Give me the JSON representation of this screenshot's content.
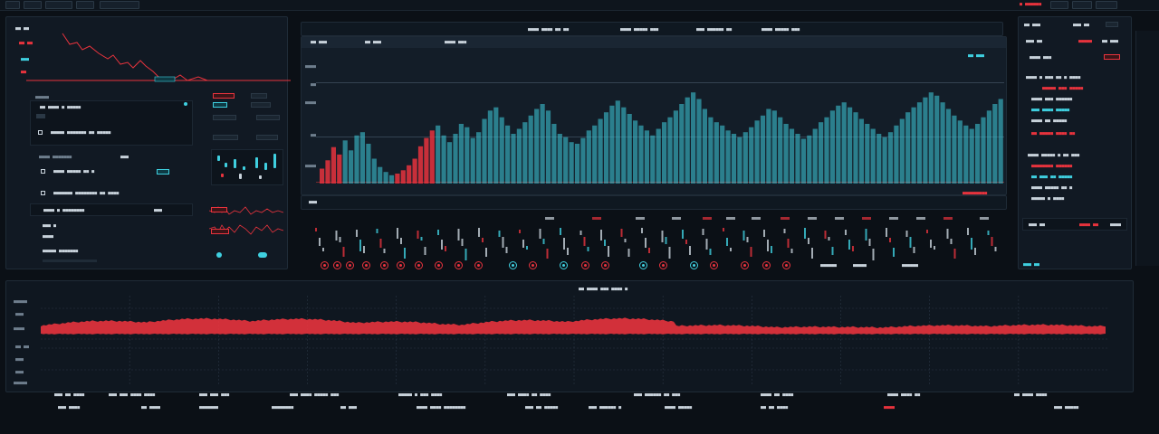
{
  "topbar": {
    "left_btns": [
      "",
      "",
      "",
      ""
    ],
    "right_red_label": "■ ■■■■■■",
    "right_items": [
      "■■",
      "■■■",
      "■■■"
    ]
  },
  "left_panel": {
    "mini_chart": {
      "labels": [
        "■■ ■■",
        "■■■",
        "■■",
        "■■"
      ],
      "header": "■■ ■■"
    },
    "list_a": {
      "title": "■■■■■",
      "rows": [
        "■■ ■■■■ ■ ■■■■■",
        "■■■■■ ■■■■■■■ ■■ ■■■■■"
      ]
    },
    "list_b": {
      "title": "■■■■ ■■■■■■■",
      "value": "■■■",
      "rows": [
        "■■■■ ■■■■■ ■■ ■",
        "■■■■■■■ ■■■■■■■■ ■■ ■■■■"
      ],
      "chip": "■■"
    },
    "list_c": {
      "rows": [
        "■■■■ ■ ■■■■■■■■",
        "■■■ ■",
        "■■■■",
        "■■■■■ ■■■■■■■"
      ],
      "value": "■■■"
    }
  },
  "mid_controls": {
    "labels": [
      "■■■■■■",
      "■■■■■",
      "■■■■■■",
      "■■■■■",
      "■■■■■■",
      "■■■■■"
    ]
  },
  "main_chart": {
    "toolbar": [
      "■■ ■■■",
      "■■ ■■■",
      "■■■■ ■■■"
    ],
    "top_tabs": [
      "■■■■ ■■■■ ■■ ■■",
      "■■■■ ■■■■■ ■■■",
      "■■■ ■■■■■■ ■■",
      "■■■■ ■■■■■ ■■■"
    ],
    "right_label": "■■ ■■■",
    "y_labels": [
      "■■■■",
      "■■",
      "■■■■",
      "■■",
      "■■■■"
    ],
    "bottom_left": "■■■",
    "bottom_right": "■■■■■■■■■"
  },
  "chart_data": {
    "type": "bar",
    "title": "",
    "series": [
      {
        "name": "",
        "values": [
          18,
          28,
          44,
          35,
          52,
          40,
          58,
          62,
          48,
          30,
          20,
          14,
          10,
          12,
          16,
          22,
          30,
          45,
          55,
          64,
          70,
          58,
          50,
          60,
          72,
          68,
          55,
          62,
          78,
          88,
          92,
          80,
          70,
          60,
          66,
          74,
          82,
          90,
          96,
          88,
          72,
          60,
          56,
          50,
          48,
          55,
          64,
          70,
          78,
          86,
          94,
          100,
          92,
          84,
          76,
          70,
          64,
          58,
          66,
          74,
          80,
          88,
          96,
          104,
          110,
          102,
          90,
          80,
          74,
          70,
          64,
          60,
          56,
          62,
          68,
          76,
          82,
          90,
          88,
          80,
          72,
          66,
          60,
          54,
          58,
          66,
          74,
          80,
          88,
          94,
          98,
          92,
          86,
          78,
          72,
          66,
          60,
          56,
          62,
          70,
          78,
          86,
          92,
          98,
          104,
          110,
          106,
          98,
          90,
          82,
          76,
          70,
          66,
          72,
          80,
          88,
          96,
          102
        ]
      }
    ]
  },
  "wave_chart": {
    "title": "■■ ■■■■ ■■■ ■■■■ ■",
    "y_labels": [
      "■■■■■",
      "■■■",
      "■■■■",
      "■■ ■■",
      "■■■",
      "■■■",
      "■■■■■"
    ],
    "x_labels": [
      "■■■ ■■ ■■■■",
      "■■■ ■■■ ■■■■ ■■■■",
      "■■■ ■■■ ■■■",
      "■■■ ■■■■ ■■■■■ ■■■",
      "■■■■■ ■ ■■■ ■■■■",
      "■■■ ■■■■ ■■ ■■■■",
      "■■■ ■■■■■■ ■■ ■■■",
      "■■■■ ■■ ■■■■",
      "■■■■ ■■■■ ■■",
      "■■ ■■■■ ■■■■"
    ],
    "legend": [
      "■■■ ■■■■",
      "■■ ■■■■",
      "■■■■■■■",
      "■■■■■■■■",
      "■■ ■■■",
      "■■■■ ■■■■ ■■■■■■■■",
      "■■■ ■■ ■■■■■",
      "■■■ ■■■■■■ ■",
      "■■■■ ■■■■■",
      "■■ ■■ ■■■■",
      "■■■■",
      "■■■ ■■■■■"
    ]
  },
  "right_panel": {
    "header": [
      "■■ ■■■",
      "■■■ ■■"
    ],
    "row2": [
      "■■■ ■■",
      "■■■■■",
      "■■ ■■■"
    ],
    "row3": [
      "■■■■ ■■■",
      "■■■"
    ],
    "block_a": [
      "■■■■ ■ ■■■ ■■ ■ ■■■■",
      "■■■■■ ■■■ ■■■■■",
      "■■■■ ■■■ ■■■■■■",
      "■■■ ■■■■ ■■■■■",
      "■■■■ ■■ ■■■■■",
      "■■ ■■■■■ ■■■■ ■■"
    ],
    "block_b": [
      "■■■■ ■■■■■ ■ ■■ ■■■",
      "■■■■■■■■ ■■■■■■",
      "■■ ■■■ ■■ ■■■■■",
      "■■■■ ■■■■■ ■■ ■",
      "■■■■■ ■ ■■■■"
    ],
    "footer": [
      "■■■ ■■",
      "■■■■ ■■",
      "■■■■"
    ]
  },
  "colors": {
    "accent_red": "#e8333d",
    "accent_cyan": "#3fd0e0",
    "bg": "#0b1016",
    "panel": "#111923"
  }
}
